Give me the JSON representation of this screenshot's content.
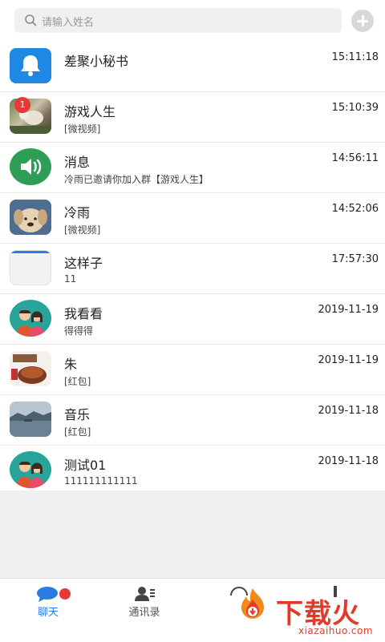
{
  "search": {
    "placeholder": "请输入姓名"
  },
  "chats": [
    {
      "name": "差聚小秘书",
      "preview": "",
      "time": "15:11:18",
      "avatar": "bell-icon"
    },
    {
      "name": "游戏人生",
      "preview": "[微视频]",
      "time": "15:10:39",
      "avatar": "photo",
      "badge": "1"
    },
    {
      "name": "消息",
      "preview": "冷雨已邀请你加入群【游戏人生】",
      "time": "14:56:11",
      "avatar": "speaker-icon"
    },
    {
      "name": "冷雨",
      "preview": "[微视频]",
      "time": "14:52:06",
      "avatar": "photo"
    },
    {
      "name": "这样子",
      "preview": "11",
      "time": "17:57:30",
      "avatar": "blank"
    },
    {
      "name": "我看看",
      "preview": " 得得得",
      "time": "2019-11-19",
      "avatar": "couple-icon"
    },
    {
      "name": "朱",
      "preview": "[红包]",
      "time": "2019-11-19",
      "avatar": "photo"
    },
    {
      "name": "音乐",
      "preview": "[红包]",
      "time": "2019-11-18",
      "avatar": "photo"
    },
    {
      "name": "测试01",
      "preview": "111111111111",
      "time": "2019-11-18",
      "avatar": "couple-icon"
    }
  ],
  "tabs": [
    {
      "label": "聊天",
      "active": true
    },
    {
      "label": "通讯录",
      "active": false
    }
  ],
  "watermark": {
    "brand": "下载火",
    "site": "xiazaihuo.com"
  },
  "colors": {
    "accent": "#2a7be4",
    "badge": "#e53935",
    "bell_bg": "#1e88e5",
    "speaker_bg": "#2e9e57",
    "couple_bg": "#27a59a",
    "watermark": "#e23a2a"
  }
}
